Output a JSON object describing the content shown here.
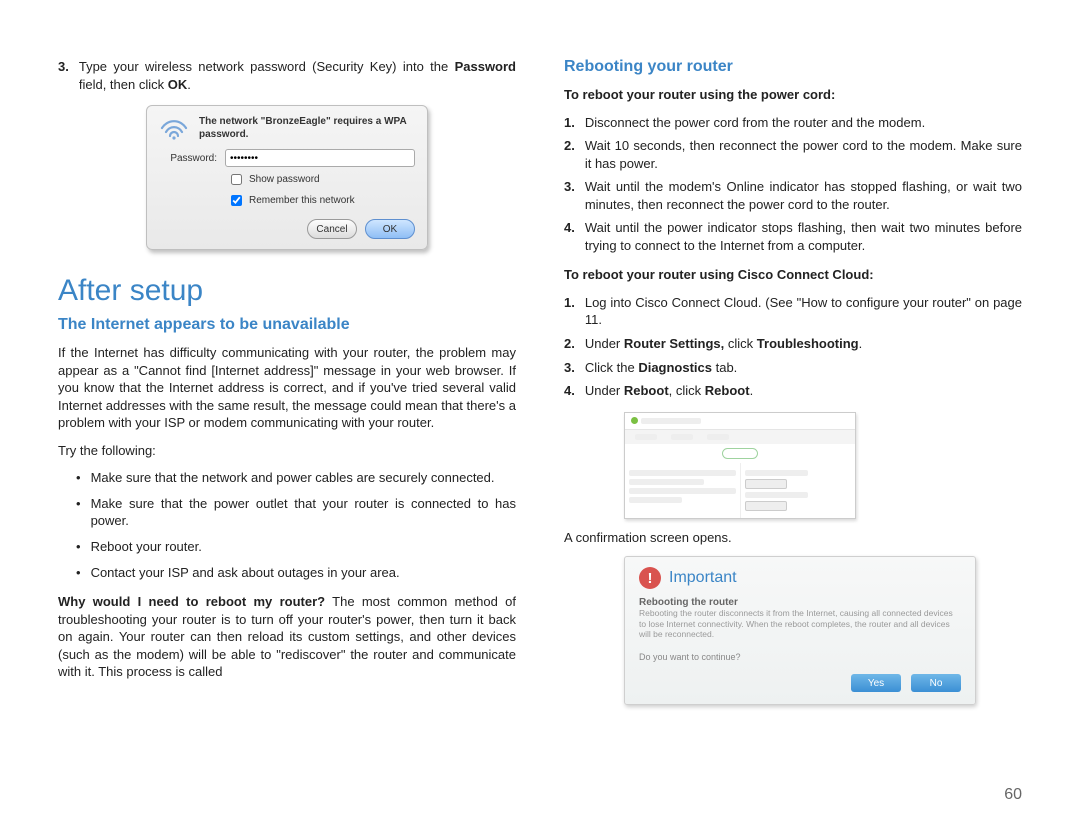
{
  "page_number": "60",
  "left": {
    "step3_num": "3.",
    "step3_a": "Type your wireless network password (Security Key) into the ",
    "step3_b": "Password",
    "step3_c": " field, then click ",
    "step3_d": "OK",
    "step3_e": ".",
    "dialog": {
      "message": "The network \"BronzeEagle\" requires a WPA password.",
      "pw_label": "Password:",
      "pw_value": "••••••••",
      "show_pw": "Show password",
      "remember": "Remember this network",
      "cancel": "Cancel",
      "ok": "OK"
    },
    "h1": "After setup",
    "h2": "The Internet appears to be unavailable",
    "para1": "If the Internet has difficulty communicating with your router, the problem may appear as a \"Cannot find [Internet address]\" message in your web browser. If you know that the Internet address is correct, and if you've tried several valid Internet addresses with the same result, the message could mean that there's a problem with your ISP or modem communicating with your router.",
    "try": "Try the following:",
    "bul1": "Make sure that the network and power cables are securely connected.",
    "bul2": "Make sure that the power outlet that your router is connected to has power.",
    "bul3": "Reboot your router.",
    "bul4": "Contact your ISP and ask about outages in your area.",
    "why_a": "Why would I need to reboot my router?",
    "why_b": " The most common method of troubleshooting your router is to turn off your router's power, then turn it back on again. Your router can then reload its custom settings, and other devices (such as the modem) will be able to \"rediscover\" the router and communicate with it. This process is called"
  },
  "right": {
    "h2": "Rebooting your router",
    "sub1": "To reboot your router using the power cord:",
    "ol1": {
      "n1": "1.",
      "t1": "Disconnect the power cord from the router and the modem.",
      "n2": "2.",
      "t2": "Wait 10 seconds, then reconnect the power cord to the modem. Make sure it has power.",
      "n3": "3.",
      "t3": "Wait until the modem's Online indicator has stopped flashing, or wait two minutes, then reconnect the power cord to the router.",
      "n4": "4.",
      "t4": "Wait until the power indicator stops flashing, then wait two minutes before trying to connect to the Internet from a computer."
    },
    "sub2": "To reboot your router using Cisco Connect Cloud:",
    "ol2": {
      "n1": "1.",
      "t1": "Log into Cisco Connect Cloud. (See \"How to configure your router\" on page 11.",
      "n2": "2.",
      "t2a": "Under ",
      "t2b": "Router Settings,",
      "t2c": " click ",
      "t2d": "Troubleshooting",
      "t2e": ".",
      "n3": "3.",
      "t3a": "Click the ",
      "t3b": "Diagnostics",
      "t3c": " tab.",
      "n4": "4.",
      "t4a": "Under ",
      "t4b": "Reboot",
      "t4c": ", click ",
      "t4d": "Reboot",
      "t4e": "."
    },
    "confirm_opens": "A confirmation screen opens.",
    "imp": {
      "title": "Important",
      "sub": "Rebooting the router",
      "body": "Rebooting the router disconnects it from the Internet, causing all connected devices to lose Internet connectivity. When the reboot completes, the router and all devices will be reconnected.",
      "q": "Do you want to continue?",
      "yes": "Yes",
      "no": "No"
    }
  }
}
